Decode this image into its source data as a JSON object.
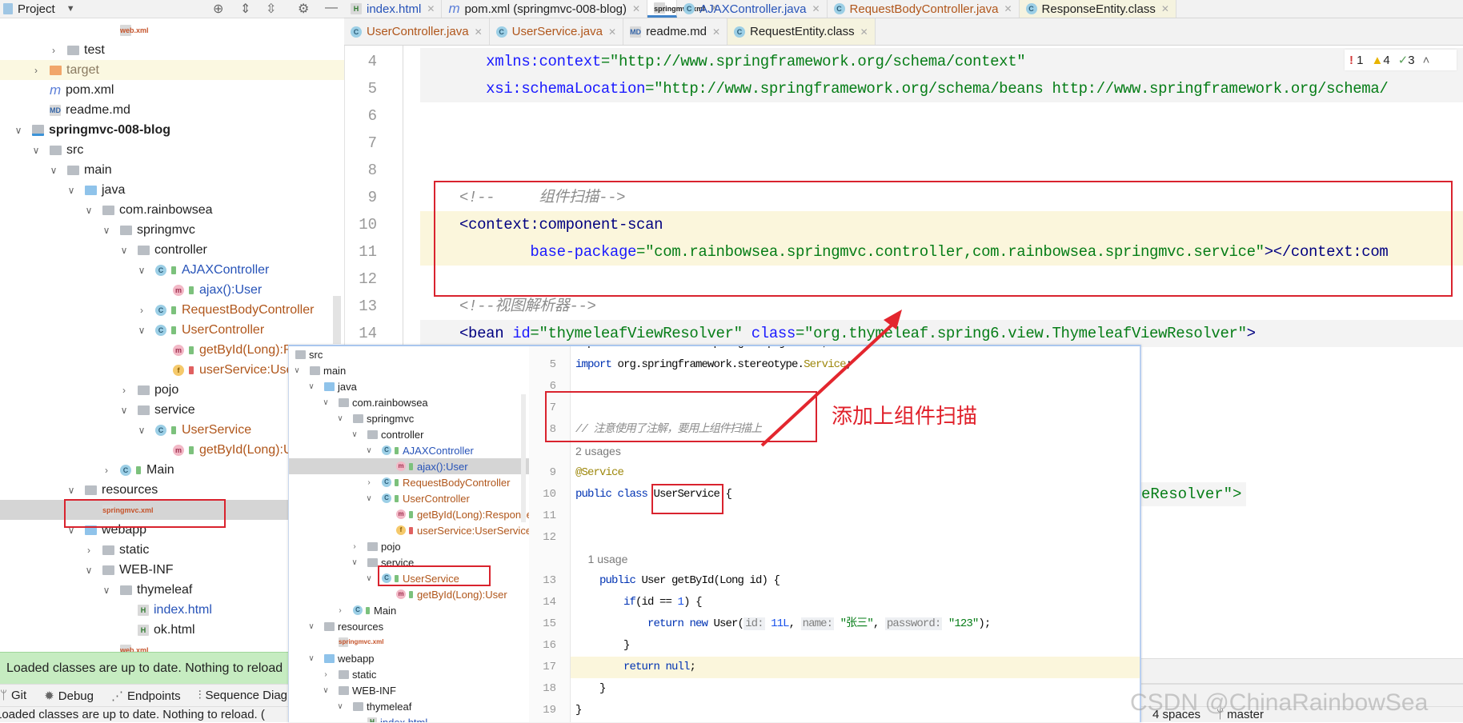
{
  "project_header": {
    "title": "Project",
    "dropdown_icon": "chevron-down-icon",
    "icons": [
      "locate-icon",
      "expand-all-icon",
      "collapse-all-icon",
      "gear-icon",
      "minimize-icon"
    ]
  },
  "tabs_row1": [
    {
      "label": "index.html",
      "icon": "html",
      "color": "#2753b8"
    },
    {
      "label": "pom.xml (springmvc-008-blog)",
      "icon": "mvn",
      "color": "#222222"
    },
    {
      "label": "springmvc.xml",
      "icon": "xml",
      "color": "#222222",
      "active": true
    },
    {
      "label": "AJAXController.java",
      "icon": "c",
      "color": "#2753b8"
    },
    {
      "label": "RequestBodyController.java",
      "icon": "c",
      "color": "#b0561b"
    },
    {
      "label": "ResponseEntity.class",
      "icon": "c",
      "color": "#222222",
      "readonly": true
    }
  ],
  "tabs_row2": [
    {
      "label": "UserController.java",
      "icon": "c",
      "color": "#b0561b"
    },
    {
      "label": "UserService.java",
      "icon": "c",
      "color": "#b0561b"
    },
    {
      "label": "readme.md",
      "icon": "md",
      "color": "#222222"
    },
    {
      "label": "RequestEntity.class",
      "icon": "c",
      "color": "#222222",
      "readonly": true
    }
  ],
  "inspections": {
    "errors": "1",
    "warnings": "4",
    "weak_warnings": "3"
  },
  "project_tree": [
    {
      "label": "web.xml",
      "level": 5,
      "chev": "",
      "icon": "xml",
      "color": ""
    },
    {
      "label": "test",
      "level": 2,
      "chev": "right",
      "icon": "folder",
      "color": ""
    },
    {
      "label": "target",
      "level": 1,
      "chev": "right",
      "icon": "folder orange",
      "color": "dim",
      "highlight": true
    },
    {
      "label": "pom.xml",
      "level": 1,
      "chev": "",
      "icon": "mvn",
      "color": ""
    },
    {
      "label": "readme.md",
      "level": 1,
      "chev": "",
      "icon": "md",
      "color": ""
    },
    {
      "label": "springmvc-008-blog",
      "level": 0,
      "chev": "down",
      "icon": "module",
      "color": "",
      "bold": true
    },
    {
      "label": "src",
      "level": 1,
      "chev": "down",
      "icon": "folder",
      "color": ""
    },
    {
      "label": "main",
      "level": 2,
      "chev": "down",
      "icon": "folder",
      "color": ""
    },
    {
      "label": "java",
      "level": 3,
      "chev": "down",
      "icon": "folder blue",
      "color": ""
    },
    {
      "label": "com.rainbowsea",
      "level": 4,
      "chev": "down",
      "icon": "pkg",
      "color": ""
    },
    {
      "label": "springmvc",
      "level": 5,
      "chev": "down",
      "icon": "pkg",
      "color": ""
    },
    {
      "label": "controller",
      "level": 6,
      "chev": "down",
      "icon": "pkg",
      "color": ""
    },
    {
      "label": "AJAXController",
      "level": 7,
      "chev": "down",
      "icon": "c",
      "color": "blue",
      "lock": "green"
    },
    {
      "label": "ajax():User",
      "level": 8,
      "chev": "",
      "icon": "m",
      "color": "blue",
      "lock": "green"
    },
    {
      "label": "RequestBodyController",
      "level": 7,
      "chev": "right",
      "icon": "c",
      "color": "orange",
      "lock": "green"
    },
    {
      "label": "UserController",
      "level": 7,
      "chev": "down",
      "icon": "c",
      "color": "orange",
      "lock": "green"
    },
    {
      "label": "getById(Long):ResponseEntity<User>",
      "level": 8,
      "chev": "",
      "icon": "m",
      "color": "orange",
      "lock": "green"
    },
    {
      "label": "userService:UserService",
      "level": 8,
      "chev": "",
      "icon": "f",
      "color": "orange",
      "lock": "red"
    },
    {
      "label": "pojo",
      "level": 6,
      "chev": "right",
      "icon": "pkg",
      "color": ""
    },
    {
      "label": "service",
      "level": 6,
      "chev": "down",
      "icon": "pkg",
      "color": ""
    },
    {
      "label": "UserService",
      "level": 7,
      "chev": "down",
      "icon": "c",
      "color": "orange",
      "lock": "green"
    },
    {
      "label": "getById(Long):User",
      "level": 8,
      "chev": "",
      "icon": "m",
      "color": "orange",
      "lock": "green"
    },
    {
      "label": "Main",
      "level": 5,
      "chev": "right",
      "icon": "c",
      "color": "",
      "lock": "green"
    },
    {
      "label": "resources",
      "level": 3,
      "chev": "down",
      "icon": "folder",
      "color": ""
    },
    {
      "label": "springmvc.xml",
      "level": 4,
      "chev": "",
      "icon": "xml",
      "color": "",
      "selected": true
    },
    {
      "label": "webapp",
      "level": 3,
      "chev": "down",
      "icon": "folder blue",
      "color": ""
    },
    {
      "label": "static",
      "level": 4,
      "chev": "right",
      "icon": "folder",
      "color": ""
    },
    {
      "label": "WEB-INF",
      "level": 4,
      "chev": "down",
      "icon": "folder",
      "color": ""
    },
    {
      "label": "thymeleaf",
      "level": 5,
      "chev": "down",
      "icon": "folder",
      "color": ""
    },
    {
      "label": "index.html",
      "level": 6,
      "chev": "",
      "icon": "html",
      "color": "blue"
    },
    {
      "label": "ok.html",
      "level": 6,
      "chev": "",
      "icon": "html",
      "color": ""
    },
    {
      "label": "web.xml",
      "level": 5,
      "chev": "",
      "icon": "xml",
      "color": ""
    }
  ],
  "main_editor": {
    "lines": [
      {
        "n": "4",
        "bg": "gray",
        "tokens": [
          [
            "   ",
            "k-plain"
          ],
          [
            "xmlns:context",
            "k-attr"
          ],
          [
            "=\"http://www.springframework.org/schema/context\"",
            "k-val"
          ]
        ]
      },
      {
        "n": "5",
        "bg": "gray",
        "tokens": [
          [
            "   ",
            "k-plain"
          ],
          [
            "xsi:schemaLocation",
            "k-attr"
          ],
          [
            "=\"http://www.springframework.org/schema/beans http://www.springframework.org/schema/",
            "k-val"
          ]
        ]
      },
      {
        "n": "6",
        "tokens": []
      },
      {
        "n": "7",
        "tokens": []
      },
      {
        "n": "8",
        "tokens": []
      },
      {
        "n": "9",
        "tokens": [
          [
            "<!--     组件扫描-->",
            "k-com"
          ]
        ]
      },
      {
        "n": "10",
        "bg": "yellow",
        "tokens": [
          [
            "<",
            "k-tag"
          ],
          [
            "context:component-scan",
            "k-tag"
          ]
        ]
      },
      {
        "n": "11",
        "bg": "yellow",
        "tokens": [
          [
            "        ",
            "k-plain"
          ],
          [
            "base-package",
            "k-attr"
          ],
          [
            "=\"com.rainbowsea.springmvc.controller,com.rainbowsea.springmvc.service\"",
            "k-val"
          ],
          [
            "></",
            "k-tag"
          ],
          [
            "context:com",
            "k-tag"
          ]
        ]
      },
      {
        "n": "12",
        "tokens": []
      },
      {
        "n": "13",
        "tokens": [
          [
            "<!--视图解析器-->",
            "k-com"
          ]
        ]
      },
      {
        "n": "14",
        "bg": "gray",
        "tokens": [
          [
            "<bean ",
            "k-tag"
          ],
          [
            "id",
            "k-attr"
          ],
          [
            "=\"thymeleafViewResolver\" ",
            "k-val"
          ],
          [
            "class",
            "k-attr"
          ],
          [
            "=\"org.thymeleaf.spring6.view.ThymeleafViewResolver\"",
            "k-val"
          ],
          [
            ">",
            "k-tag"
          ]
        ]
      }
    ],
    "hidden_line_tail": "eResolver\">"
  },
  "overlay_tree": [
    {
      "label": "src",
      "level": 0,
      "chev": "",
      "icon": "folder"
    },
    {
      "label": "main",
      "level": 1,
      "chev": "down",
      "icon": "folder"
    },
    {
      "label": "java",
      "level": 2,
      "chev": "down",
      "icon": "folder blue"
    },
    {
      "label": "com.rainbowsea",
      "level": 3,
      "chev": "down",
      "icon": "pkg"
    },
    {
      "label": "springmvc",
      "level": 4,
      "chev": "down",
      "icon": "pkg"
    },
    {
      "label": "controller",
      "level": 5,
      "chev": "down",
      "icon": "pkg"
    },
    {
      "label": "AJAXController",
      "level": 6,
      "chev": "down",
      "icon": "c",
      "color": "blue",
      "lock": "green"
    },
    {
      "label": "ajax():User",
      "level": 7,
      "chev": "",
      "icon": "m",
      "color": "blue",
      "lock": "green",
      "selected": true
    },
    {
      "label": "RequestBodyController",
      "level": 6,
      "chev": "right",
      "icon": "c",
      "color": "orange",
      "lock": "green"
    },
    {
      "label": "UserController",
      "level": 6,
      "chev": "down",
      "icon": "c",
      "color": "orange",
      "lock": "green"
    },
    {
      "label": "getById(Long):ResponseEntity<User>",
      "level": 7,
      "chev": "",
      "icon": "m",
      "color": "orange",
      "lock": "green"
    },
    {
      "label": "userService:UserService",
      "level": 7,
      "chev": "",
      "icon": "f",
      "color": "orange",
      "lock": "red"
    },
    {
      "label": "pojo",
      "level": 5,
      "chev": "right",
      "icon": "pkg"
    },
    {
      "label": "service",
      "level": 5,
      "chev": "down",
      "icon": "pkg"
    },
    {
      "label": "UserService",
      "level": 6,
      "chev": "down",
      "icon": "c",
      "color": "orange",
      "lock": "green"
    },
    {
      "label": "getById(Long):User",
      "level": 7,
      "chev": "",
      "icon": "m",
      "color": "orange",
      "lock": "green"
    },
    {
      "label": "Main",
      "level": 4,
      "chev": "right",
      "icon": "c",
      "lock": "green"
    },
    {
      "label": "resources",
      "level": 2,
      "chev": "down",
      "icon": "folder"
    },
    {
      "label": "springmvc.xml",
      "level": 3,
      "chev": "",
      "icon": "xml"
    },
    {
      "label": "webapp",
      "level": 2,
      "chev": "down",
      "icon": "folder blue"
    },
    {
      "label": "static",
      "level": 3,
      "chev": "right",
      "icon": "folder"
    },
    {
      "label": "WEB-INF",
      "level": 3,
      "chev": "down",
      "icon": "folder"
    },
    {
      "label": "thymeleaf",
      "level": 4,
      "chev": "down",
      "icon": "folder"
    },
    {
      "label": "index.html",
      "level": 5,
      "chev": "",
      "icon": "html",
      "color": "blue"
    }
  ],
  "overlay_editor": {
    "lines": [
      {
        "n": "",
        "tokens": [
          [
            "import com.rainbowsea.springmvc.pojo.User;",
            "k-plain"
          ]
        ]
      },
      {
        "n": "5",
        "tokens": [
          [
            "import ",
            "k-kw"
          ],
          [
            "org.springframework.stereotype.",
            "k-plain"
          ],
          [
            "Service",
            "k-ann"
          ],
          [
            ";",
            "k-plain"
          ]
        ]
      },
      {
        "n": "6",
        "tokens": []
      },
      {
        "n": "7",
        "tokens": []
      },
      {
        "n": "8",
        "tokens": [
          [
            "// 注意使用了注解，要用上组件扫描上",
            "k-com"
          ]
        ]
      },
      {
        "n": "",
        "hint": true,
        "tokens": [
          [
            "2 usages",
            "k-com-plain"
          ]
        ]
      },
      {
        "n": "9",
        "tokens": [
          [
            "@Service",
            "k-ann"
          ]
        ]
      },
      {
        "n": "10",
        "tokens": [
          [
            "public class ",
            "k-kw"
          ],
          [
            "UserService",
            "k-plain"
          ],
          [
            " {",
            "k-plain"
          ]
        ]
      },
      {
        "n": "11",
        "tokens": []
      },
      {
        "n": "12",
        "tokens": []
      },
      {
        "n": "",
        "hint": true,
        "tokens": [
          [
            "    1 usage",
            "k-com-plain"
          ]
        ]
      },
      {
        "n": "13",
        "tokens": [
          [
            "    ",
            "k-plain"
          ],
          [
            "public ",
            "k-kw"
          ],
          [
            "User getById(Long id) {",
            "k-plain"
          ]
        ]
      },
      {
        "n": "14",
        "tokens": [
          [
            "        ",
            "k-plain"
          ],
          [
            "if",
            "k-kw"
          ],
          [
            "(id == ",
            "k-plain"
          ],
          [
            "1",
            "k-num"
          ],
          [
            ") {",
            "k-plain"
          ]
        ]
      },
      {
        "n": "15",
        "tokens": [
          [
            "            ",
            "k-plain"
          ],
          [
            "return new ",
            "k-kw"
          ],
          [
            "User(",
            "k-plain"
          ],
          [
            "id:",
            "k-hint"
          ],
          [
            " ",
            "k-plain"
          ],
          [
            "11L",
            "k-num"
          ],
          [
            ", ",
            "k-plain"
          ],
          [
            "name:",
            "k-hint"
          ],
          [
            " ",
            "k-plain"
          ],
          [
            "\"张三\"",
            "k-str"
          ],
          [
            ", ",
            "k-plain"
          ],
          [
            "password:",
            "k-hint"
          ],
          [
            " ",
            "k-plain"
          ],
          [
            "\"123\"",
            "k-str"
          ],
          [
            ");",
            "k-plain"
          ]
        ]
      },
      {
        "n": "16",
        "tokens": [
          [
            "        }",
            "k-plain"
          ]
        ]
      },
      {
        "n": "17",
        "bg": "yellow",
        "tokens": [
          [
            "        ",
            "k-plain"
          ],
          [
            "return null",
            "k-kw"
          ],
          [
            ";",
            "k-plain"
          ]
        ]
      },
      {
        "n": "18",
        "tokens": [
          [
            "    }",
            "k-plain"
          ]
        ]
      },
      {
        "n": "19",
        "tokens": [
          [
            "}",
            "k-plain"
          ]
        ]
      }
    ]
  },
  "annotation": {
    "text": "添加上组件扫描",
    "color": "#e0202a"
  },
  "notification": {
    "text": "Loaded classes are up to date. Nothing to reload"
  },
  "bottom_toolbar": [
    {
      "label": "Git",
      "icon": "git-branch-icon"
    },
    {
      "label": "Debug",
      "icon": "bug-icon"
    },
    {
      "label": "Endpoints",
      "icon": "endpoints-icon"
    },
    {
      "label": "Sequence Diagram",
      "icon": "sequence-diagram-icon"
    }
  ],
  "status_bar": {
    "message": "Loaded classes are up to date. Nothing to reload. (",
    "indent": "4 spaces",
    "branch": "master"
  },
  "watermark": "CSDN @ChinaRainbowSea"
}
